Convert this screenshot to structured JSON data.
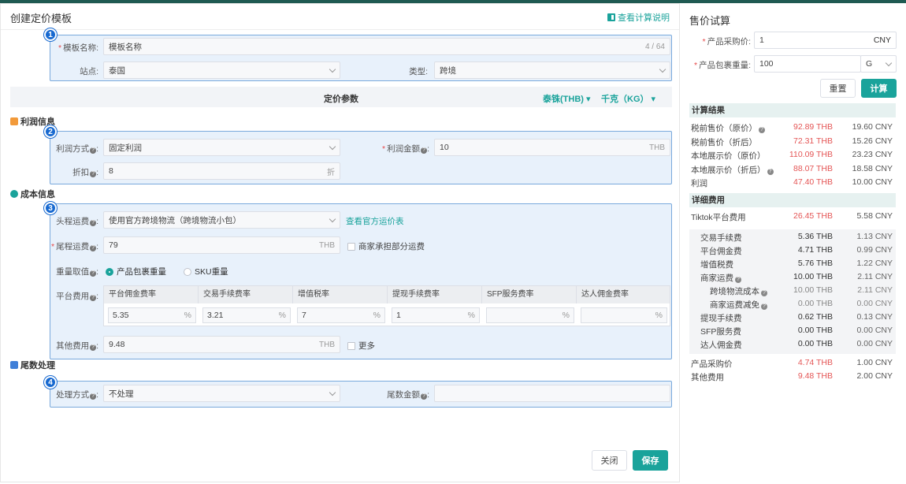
{
  "colors": {
    "accent": "#1aa39b",
    "highlight_border": "#79a9dc",
    "highlight_bg": "#e8f1fb",
    "badge": "#1769d0",
    "price_red": "#e45555"
  },
  "header": {
    "title": "创建定价模板",
    "help_link": "查看计算说明"
  },
  "section1": {
    "badge": "1",
    "template_name_label": "模板名称:",
    "template_name_value": "模板名称",
    "template_name_count": "4 / 64",
    "site_label": "站点:",
    "site_value": "泰国",
    "type_label": "类型:",
    "type_value": "跨境"
  },
  "param_bar": {
    "title": "定价参数",
    "currency": "泰铢(THB)",
    "weight_unit": "千克（KG）"
  },
  "profit": {
    "title": "利润信息",
    "badge": "2",
    "method_label": "利润方式",
    "method_value": "固定利润",
    "amount_label": "利润金额",
    "amount_value": "10",
    "amount_suffix": "THB",
    "discount_label": "折扣",
    "discount_value": "8",
    "discount_suffix": "折"
  },
  "cost": {
    "title": "成本信息",
    "badge": "3",
    "first_leg_label": "头程运费",
    "first_leg_value": "使用官方跨境物流（跨境物流小包）",
    "first_leg_link": "查看官方运价表",
    "last_leg_label": "尾程运费",
    "last_leg_value": "79",
    "last_leg_suffix": "THB",
    "merchant_share_label": "商家承担部分运费",
    "weight_label": "重量取值",
    "weight_opt1": "产品包裹重量",
    "weight_opt2": "SKU重量",
    "platform_fee_label": "平台费用",
    "fee_headers": [
      "平台佣金费率",
      "交易手续费率",
      "增值税率",
      "提现手续费率",
      "SFP服务费率",
      "达人佣金费率"
    ],
    "fee_values": [
      "5.35",
      "3.21",
      "7",
      "1",
      "",
      ""
    ],
    "fee_suffix": "%",
    "other_label": "其他费用",
    "other_value": "9.48",
    "other_suffix": "THB",
    "more_label": "更多"
  },
  "tail": {
    "title": "尾数处理",
    "badge": "4",
    "method_label": "处理方式",
    "method_value": "不处理",
    "amount_label": "尾数金额"
  },
  "footer": {
    "close": "关闭",
    "save": "保存"
  },
  "trial": {
    "title": "售价试算",
    "purchase_label": "产品采购价:",
    "purchase_value": "1",
    "purchase_unit": "CNY",
    "weight_label": "产品包裹重量:",
    "weight_value": "100",
    "weight_unit": "G",
    "reset": "重置",
    "calc": "计算",
    "result_title": "计算结果",
    "results": [
      {
        "name": "税前售价（原价）",
        "help": true,
        "thb": "92.89 THB",
        "cny": "19.60 CNY"
      },
      {
        "name": "税前售价（折后）",
        "help": false,
        "thb": "72.31 THB",
        "cny": "15.26 CNY"
      },
      {
        "name": "本地展示价（原价）",
        "help": false,
        "thb": "110.09 THB",
        "cny": "23.23 CNY"
      },
      {
        "name": "本地展示价（折后）",
        "help": true,
        "thb": "88.07 THB",
        "cny": "18.58 CNY"
      },
      {
        "name": "利润",
        "help": false,
        "thb": "47.40 THB",
        "cny": "10.00 CNY"
      }
    ],
    "detail_title": "详细费用",
    "tiktok_fee": {
      "name": "Tiktok平台费用",
      "thb": "26.45 THB",
      "cny": "5.58 CNY"
    },
    "details": [
      {
        "name": "交易手续费",
        "help": false,
        "thb": "5.36 THB",
        "cny": "1.13 CNY"
      },
      {
        "name": "平台佣金费",
        "help": false,
        "thb": "4.71 THB",
        "cny": "0.99 CNY"
      },
      {
        "name": "增值税费",
        "help": false,
        "thb": "5.76 THB",
        "cny": "1.22 CNY"
      },
      {
        "name": "商家运费",
        "help": true,
        "thb": "10.00 THB",
        "cny": "2.11 CNY"
      },
      {
        "name": "跨境物流成本",
        "help": true,
        "thb": "10.00 THB",
        "cny": "2.11 CNY",
        "sub": true
      },
      {
        "name": "商家运费减免",
        "help": true,
        "thb": "0.00 THB",
        "cny": "0.00 CNY",
        "sub": true
      },
      {
        "name": "提现手续费",
        "help": false,
        "thb": "0.62 THB",
        "cny": "0.13 CNY"
      },
      {
        "name": "SFP服务费",
        "help": false,
        "thb": "0.00 THB",
        "cny": "0.00 CNY"
      },
      {
        "name": "达人佣金费",
        "help": false,
        "thb": "0.00 THB",
        "cny": "0.00 CNY"
      }
    ],
    "bottom": [
      {
        "name": "产品采购价",
        "thb": "4.74 THB",
        "cny": "1.00 CNY"
      },
      {
        "name": "其他费用",
        "thb": "9.48 THB",
        "cny": "2.00 CNY"
      }
    ]
  }
}
